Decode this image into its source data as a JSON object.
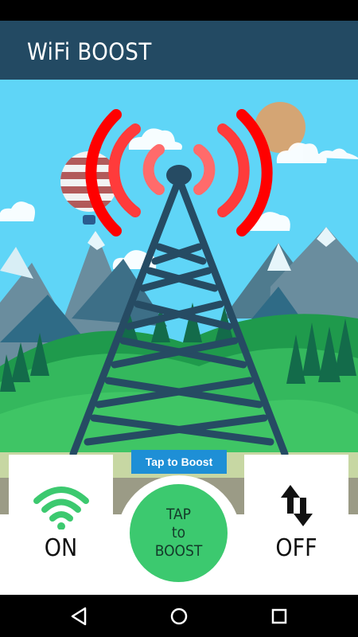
{
  "app": {
    "title": "WiFi BOOST"
  },
  "boost": {
    "badge_label": "Tap to Boost",
    "button_lines": [
      "TAP",
      "to",
      "BOOST"
    ]
  },
  "left_panel": {
    "icon": "wifi-icon",
    "label": "ON"
  },
  "right_panel": {
    "icon": "data-transfer-icon",
    "label": "OFF"
  },
  "nav": {
    "icons": [
      "back-icon",
      "home-icon",
      "recents-icon"
    ]
  },
  "colors": {
    "appbar": "#234a63",
    "sky": "#5fd5f7",
    "signal_wave": "#ff0000",
    "tower": "#264b63",
    "boost_button": "#3cc96f",
    "badge": "#1e8fd6",
    "wifi_icon": "#3cc96f"
  }
}
